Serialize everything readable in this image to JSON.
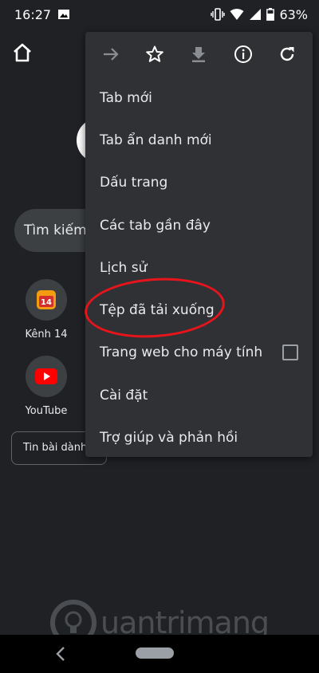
{
  "status_bar": {
    "time": "16:27",
    "battery": "63%"
  },
  "ntp": {
    "search_placeholder": "Tìm kiếm",
    "tiles": [
      {
        "label": "Kênh 14",
        "icon": "kenh14-icon"
      },
      {
        "label": "YouTube",
        "icon": "youtube-icon"
      }
    ],
    "news_label": "Tin bài dành"
  },
  "menu": {
    "toolbar": [
      "forward-icon",
      "star-icon",
      "download-icon",
      "info-icon",
      "refresh-icon"
    ],
    "items": [
      {
        "label": "Tab mới"
      },
      {
        "label": "Tab ẩn danh mới"
      },
      {
        "label": "Dấu trang"
      },
      {
        "label": "Các tab gần đây"
      },
      {
        "label": "Lịch sử"
      },
      {
        "label": "Tệp đã tải xuống"
      },
      {
        "label": "Trang web cho máy tính"
      },
      {
        "label": "Cài đặt"
      },
      {
        "label": "Trợ giúp và phản hồi"
      }
    ]
  },
  "watermark": {
    "text": "uantrimang"
  },
  "colors": {
    "background": "#202124",
    "menu": "#303134",
    "highlight": "#e8141c",
    "youtube": "#ff0000"
  }
}
